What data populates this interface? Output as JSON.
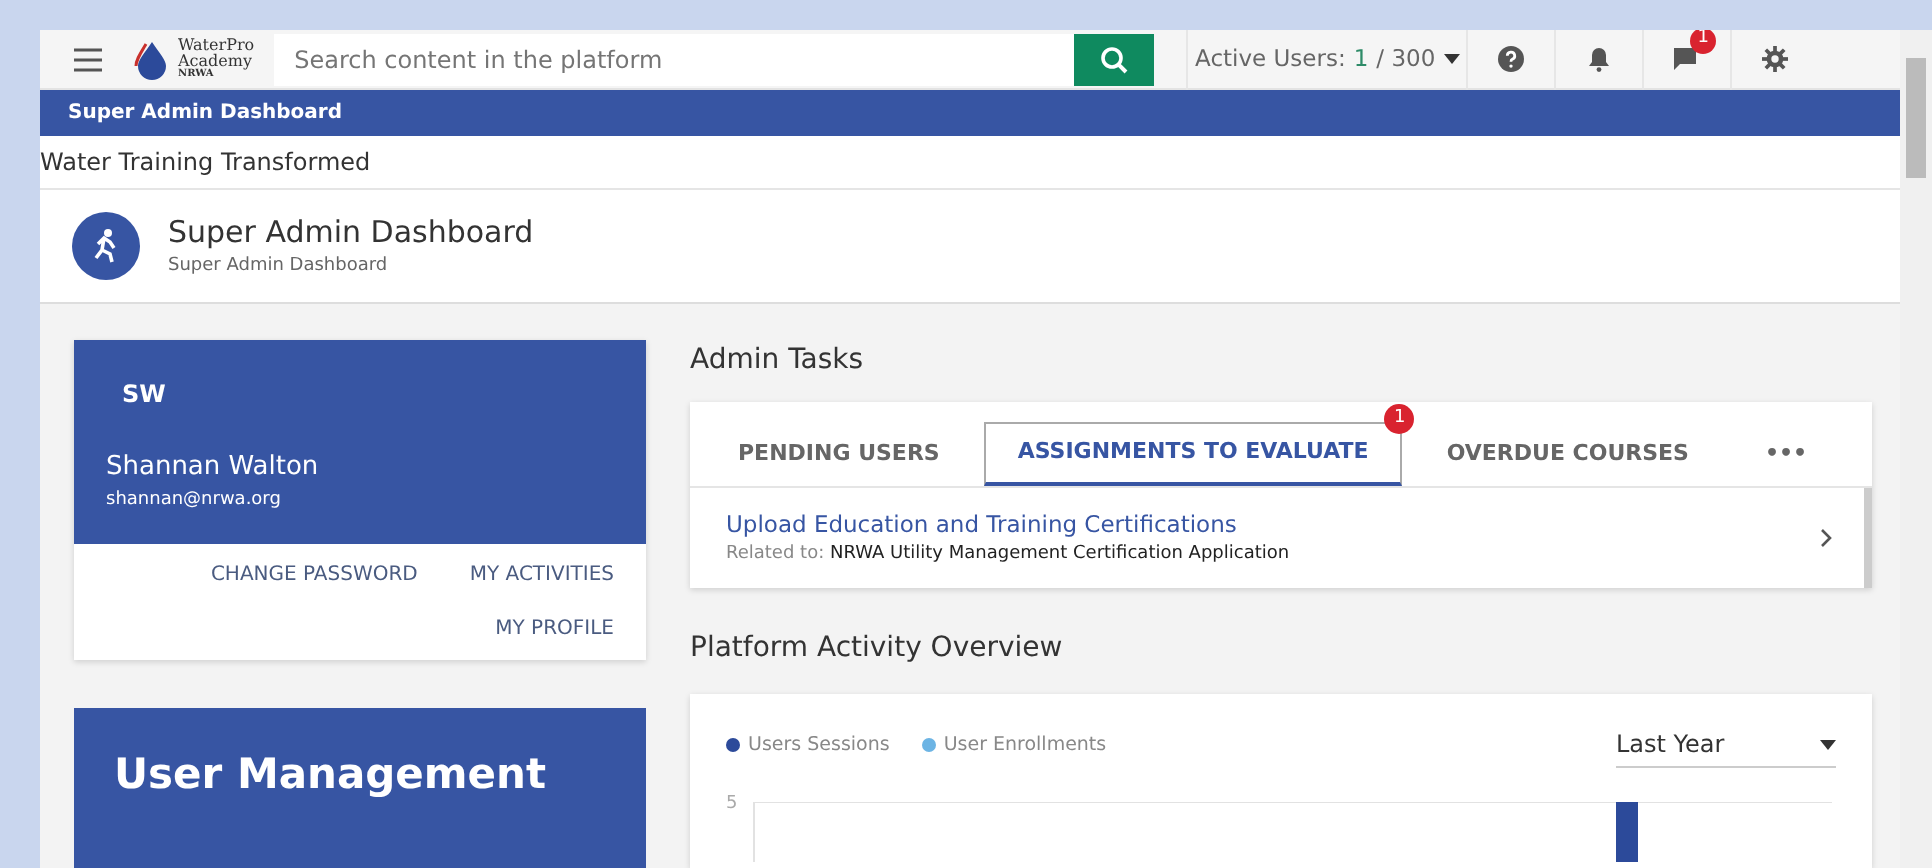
{
  "topbar": {
    "logo_lines": [
      "WaterPro",
      "Academy"
    ],
    "logo_sub": "NRWA",
    "search": {
      "placeholder": "Search content in the platform"
    },
    "active_users": {
      "label": "Active Users:",
      "current": "1",
      "total": " / 300"
    },
    "messages_badge": "1"
  },
  "breadcrumb": "Super Admin Dashboard",
  "tagline": "Water Training Transformed",
  "page_header": {
    "title": "Super Admin Dashboard",
    "subtitle": "Super Admin Dashboard"
  },
  "profile": {
    "initials": "SW",
    "name": "Shannan Walton",
    "email": "shannan@nrwa.org",
    "links": [
      "CHANGE PASSWORD",
      "MY ACTIVITIES",
      "MY PROFILE"
    ]
  },
  "user_management": {
    "title": "User Management"
  },
  "admin_tasks": {
    "title": "Admin Tasks",
    "tabs": [
      {
        "label": "PENDING USERS",
        "selected": false
      },
      {
        "label": "ASSIGNMENTS TO EVALUATE",
        "selected": true,
        "badge": "1"
      },
      {
        "label": "OVERDUE COURSES",
        "selected": false
      },
      {
        "label": "•••",
        "selected": false
      }
    ],
    "items": [
      {
        "title": "Upload Education and Training Certifications",
        "related_label": "Related to:",
        "related": "NRWA Utility Management Certification Application"
      }
    ]
  },
  "activity": {
    "title": "Platform Activity Overview",
    "legend": [
      {
        "name": "Users Sessions",
        "color": "#2c4a9a"
      },
      {
        "name": "User Enrollments",
        "color": "#6cb4e4"
      }
    ],
    "period": "Last Year",
    "y_tick": "5"
  }
}
